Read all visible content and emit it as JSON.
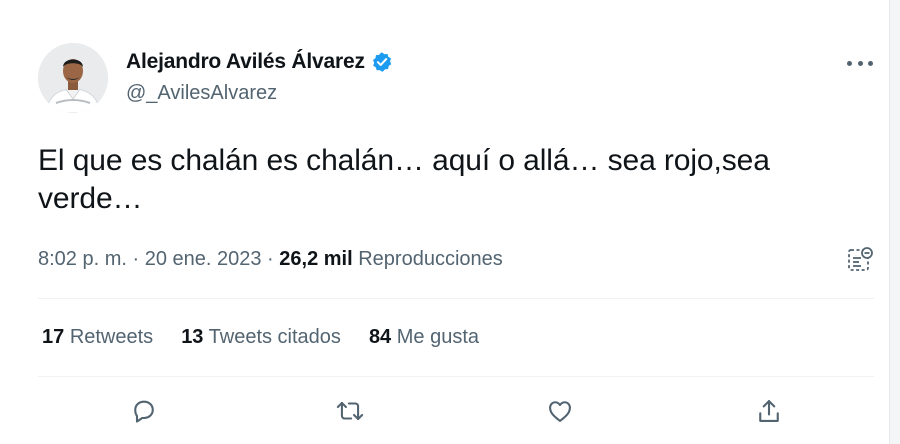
{
  "author": {
    "name": "Alejandro Avilés Álvarez",
    "handle": "@_AvilesAlvarez",
    "verified": true
  },
  "tweet": {
    "text": "El que es chalán es chalán… aquí o allá… sea rojo,sea verde…"
  },
  "meta": {
    "time": "8:02 p. m.",
    "separator1": " · ",
    "date": "20 ene. 2023",
    "separator2": " · ",
    "views_count": "26,2 mil",
    "views_label": " Reproducciones"
  },
  "stats": [
    {
      "count": "17",
      "label": "Retweets"
    },
    {
      "count": "13",
      "label": "Tweets citados"
    },
    {
      "count": "84",
      "label": "Me gusta"
    }
  ],
  "icons": {
    "verified": "verified-badge-icon",
    "more": "more-options-icon",
    "analytics": "analytics-icon",
    "reply": "reply-icon",
    "retweet": "retweet-icon",
    "like": "like-icon",
    "share": "share-icon"
  },
  "colors": {
    "text_primary": "#0f1419",
    "text_secondary": "#536471",
    "verified_blue": "#1d9bf0",
    "divider": "#eff3f4"
  }
}
